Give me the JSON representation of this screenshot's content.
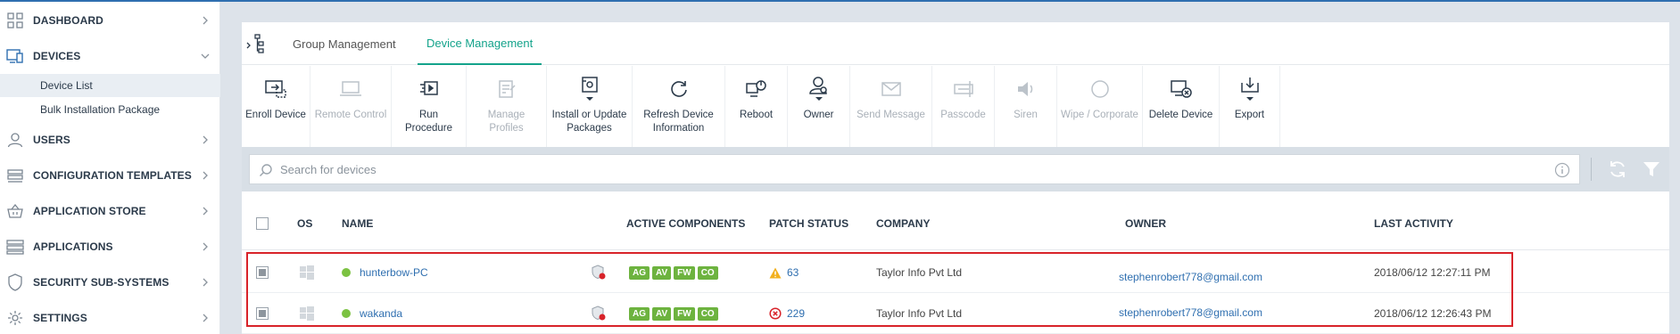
{
  "sidebar": {
    "items": [
      {
        "label": "DASHBOARD",
        "icon": "dashboard-grid-icon"
      },
      {
        "label": "DEVICES",
        "icon": "devices-icon"
      },
      {
        "label": "USERS",
        "icon": "user-icon"
      },
      {
        "label": "CONFIGURATION TEMPLATES",
        "icon": "layers-icon"
      },
      {
        "label": "APPLICATION STORE",
        "icon": "basket-icon"
      },
      {
        "label": "APPLICATIONS",
        "icon": "applications-icon"
      },
      {
        "label": "SECURITY SUB-SYSTEMS",
        "icon": "shield-icon"
      },
      {
        "label": "SETTINGS",
        "icon": "gear-icon"
      }
    ],
    "devices_sub": [
      {
        "label": "Device List"
      },
      {
        "label": "Bulk Installation Package"
      }
    ]
  },
  "tabs": [
    {
      "label": "Group Management"
    },
    {
      "label": "Device Management"
    }
  ],
  "toolbar": {
    "items": [
      {
        "label": "Enroll Device",
        "icon": "enroll-device-icon",
        "enabled": true
      },
      {
        "label": "Remote Control",
        "icon": "laptop-icon",
        "enabled": false
      },
      {
        "label": "Run Procedure",
        "icon": "run-procedure-icon",
        "enabled": true
      },
      {
        "label": "Manage Profiles",
        "icon": "profiles-icon",
        "enabled": false
      },
      {
        "label": "Install or Update Packages",
        "icon": "package-icon",
        "enabled": true
      },
      {
        "label": "Refresh Device Information",
        "icon": "refresh-icon",
        "enabled": true
      },
      {
        "label": "Reboot",
        "icon": "reboot-icon",
        "enabled": true
      },
      {
        "label": "Owner",
        "icon": "owner-icon",
        "enabled": true
      },
      {
        "label": "Send Message",
        "icon": "envelope-icon",
        "enabled": false
      },
      {
        "label": "Passcode",
        "icon": "passcode-icon",
        "enabled": false
      },
      {
        "label": "Siren",
        "icon": "speaker-icon",
        "enabled": false
      },
      {
        "label": "Wipe / Corporate",
        "icon": "wipe-circle-icon",
        "enabled": false
      },
      {
        "label": "Delete Device",
        "icon": "delete-device-icon",
        "enabled": true
      },
      {
        "label": "Export",
        "icon": "export-icon",
        "enabled": true
      }
    ]
  },
  "search": {
    "placeholder": "Search for devices"
  },
  "table": {
    "headers": {
      "os": "OS",
      "name": "NAME",
      "active_components": "ACTIVE COMPONENTS",
      "patch_status": "PATCH STATUS",
      "company": "COMPANY",
      "owner": "OWNER",
      "last_activity": "LAST ACTIVITY"
    },
    "rows": [
      {
        "name": "hunterbow-PC",
        "components": [
          "AG",
          "AV",
          "FW",
          "CO"
        ],
        "patch_icon": "warning-triangle-icon",
        "patch_count": "63",
        "company": "Taylor Info Pvt Ltd",
        "owner": "stephenrobert778@gmail.com",
        "last_activity": "2018/06/12 12:27:11 PM"
      },
      {
        "name": "wakanda",
        "components": [
          "AG",
          "AV",
          "FW",
          "CO"
        ],
        "patch_icon": "error-circle-icon",
        "patch_count": "229",
        "company": "Taylor Info Pvt Ltd",
        "owner": "stephenrobert778@gmail.com",
        "last_activity": "2018/06/12 12:26:43 PM"
      }
    ]
  },
  "colors": {
    "accent": "#14a38b",
    "link": "#2f6fb0",
    "status_online": "#7cc242",
    "badge_green": "#6db33f",
    "highlight_red": "#d8232a"
  }
}
